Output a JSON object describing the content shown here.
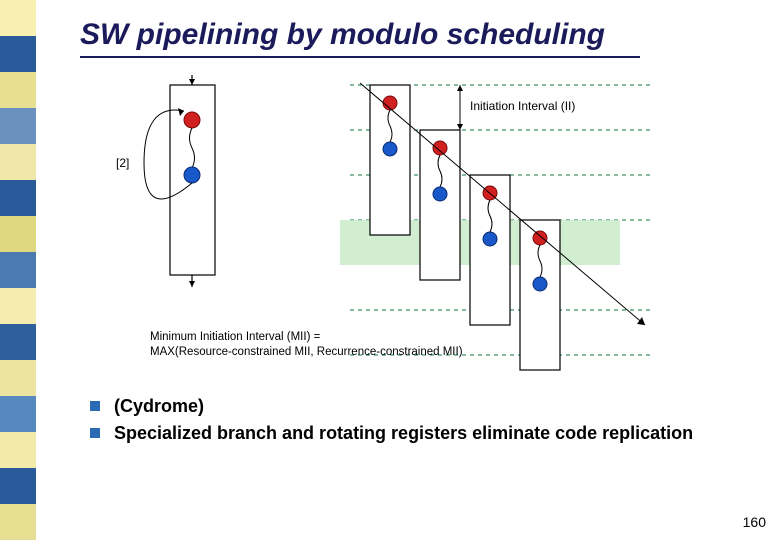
{
  "title": "SW pipelining by modulo scheduling",
  "sidebar_colors": [
    "#f8f0b0",
    "#2a5a9a",
    "#e8e090",
    "#6a90c0",
    "#f0e8a8",
    "#2a5a9a",
    "#e0d880",
    "#4a7ab0",
    "#f5edb0",
    "#305f9e",
    "#ece4a0",
    "#5888c0",
    "#f2eaa8",
    "#2a5a9a",
    "#e6de90"
  ],
  "diagram": {
    "loop_back_label": "[2]",
    "ii_label": "Initiation Interval (II)",
    "mii_line1": "Minimum Initiation Interval (MII) =",
    "mii_line2": "MAX(Resource-constrained MII, Recurrence-constrained MII)"
  },
  "bullets": [
    "(Cydrome)",
    "Specialized branch and rotating registers eliminate code replication"
  ],
  "page_number": "160"
}
